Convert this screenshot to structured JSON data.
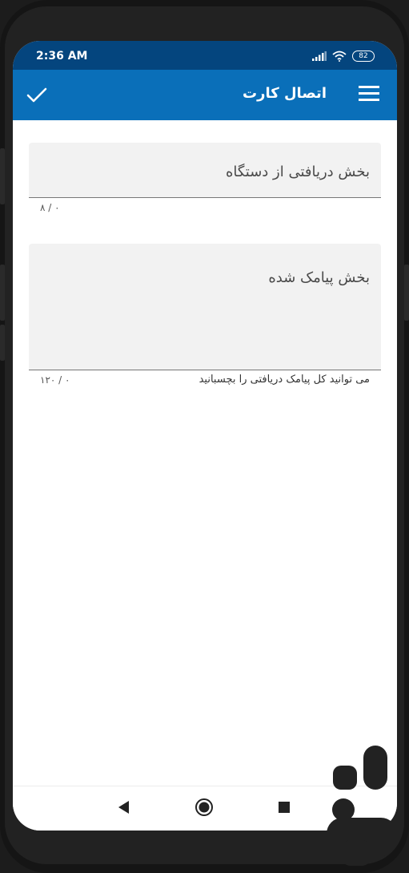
{
  "status_bar": {
    "time": "2:36 AM",
    "battery_level": "82",
    "icons": [
      "signal-icon",
      "wifi-icon",
      "battery-icon"
    ]
  },
  "app_bar": {
    "title": "اتصال کارت",
    "confirm_icon": "check-icon",
    "menu_icon": "hamburger-menu-icon"
  },
  "form": {
    "device_field": {
      "placeholder": "بخش دریافتی از دستگاه",
      "counter": "۰ / ۸"
    },
    "sms_field": {
      "placeholder": "بخش پیامک شده",
      "helper": "می توانید کل پیامک دریافتی را بچسبانید",
      "counter": "۰ / ۱۲۰"
    }
  },
  "nav_bar": {
    "buttons": [
      "back-icon",
      "home-icon",
      "recents-icon"
    ]
  },
  "colors": {
    "status_bar": "#04457e",
    "app_bar": "#0a6fb9",
    "field_bg": "#f2f2f2"
  }
}
